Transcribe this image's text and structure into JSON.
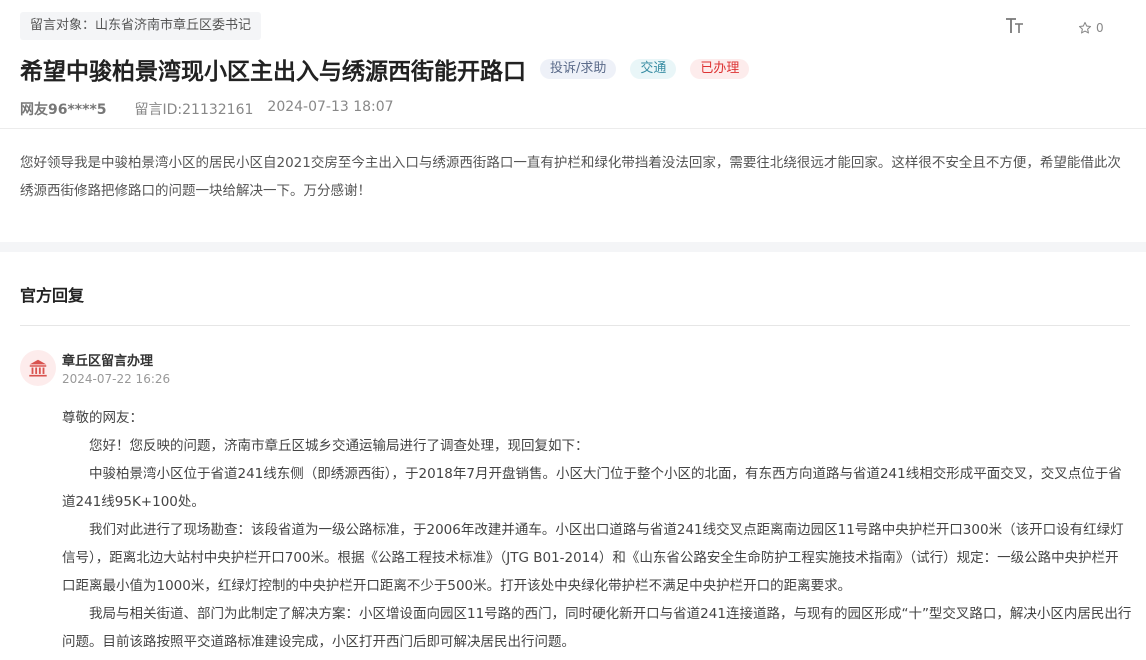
{
  "message": {
    "target": "留言对象：山东省济南市章丘区委书记",
    "title": "希望中骏柏景湾现小区主出入与绣源西街能开路口",
    "tags": {
      "type": "投诉/求助",
      "field": "交通",
      "status": "已办理"
    },
    "user": "网友96****5",
    "id": "留言ID:21132161",
    "datetime": "2024-07-13 18:07",
    "star_count": "0",
    "content": "您好领导我是中骏柏景湾小区的居民小区自2021交房至今主出入口与绣源西街路口一直有护栏和绿化带挡着没法回家，需要往北绕很远才能回家。这样很不安全且不方便，希望能借此次绣源西街修路把修路口的问题一块给解决一下。万分感谢！"
  },
  "toolbar": {
    "font_size_icon": "text-size-icon",
    "star_icon": "star-icon"
  },
  "reply": {
    "heading": "官方回复",
    "org": "章丘区留言办理",
    "time": "2024-07-22 16:26",
    "avatar_icon": "government-building-icon",
    "paragraphs": [
      "尊敬的网友：",
      "您好！您反映的问题，济南市章丘区城乡交通运输局进行了调查处理，现回复如下：",
      "中骏柏景湾小区位于省道241线东侧（即绣源西街），于2018年7月开盘销售。小区大门位于整个小区的北面，有东西方向道路与省道241线相交形成平面交叉，交叉点位于省道241线95K+100处。",
      "我们对此进行了现场勘查：该段省道为一级公路标准，于2006年改建并通车。小区出口道路与省道241线交叉点距离南边园区11号路中央护栏开口300米（该开口设有红绿灯信号），距离北边大站村中央护栏开口700米。根据《公路工程技术标准》（JTG B01-2014）和《山东省公路安全生命防护工程实施技术指南》（试行）规定：一级公路中央护栏开口距离最小值为1000米，红绿灯控制的中央护栏开口距离不少于500米。打开该处中央绿化带护栏不满足中央护栏开口的距离要求。",
      "我局与相关街道、部门为此制定了解决方案：小区增设面向园区11号路的西门，同时硬化新开口与省道241连接道路，与现有的园区形成“十”型交叉路口，解决小区内居民出行问题。目前该路按照平交道路标准建设完成，小区打开西门后即可解决居民出行问题。"
    ]
  },
  "colors": {
    "status_red": "#d33",
    "tag_blue": "#3a8ea4",
    "avatar_bg": "#fdecec"
  }
}
